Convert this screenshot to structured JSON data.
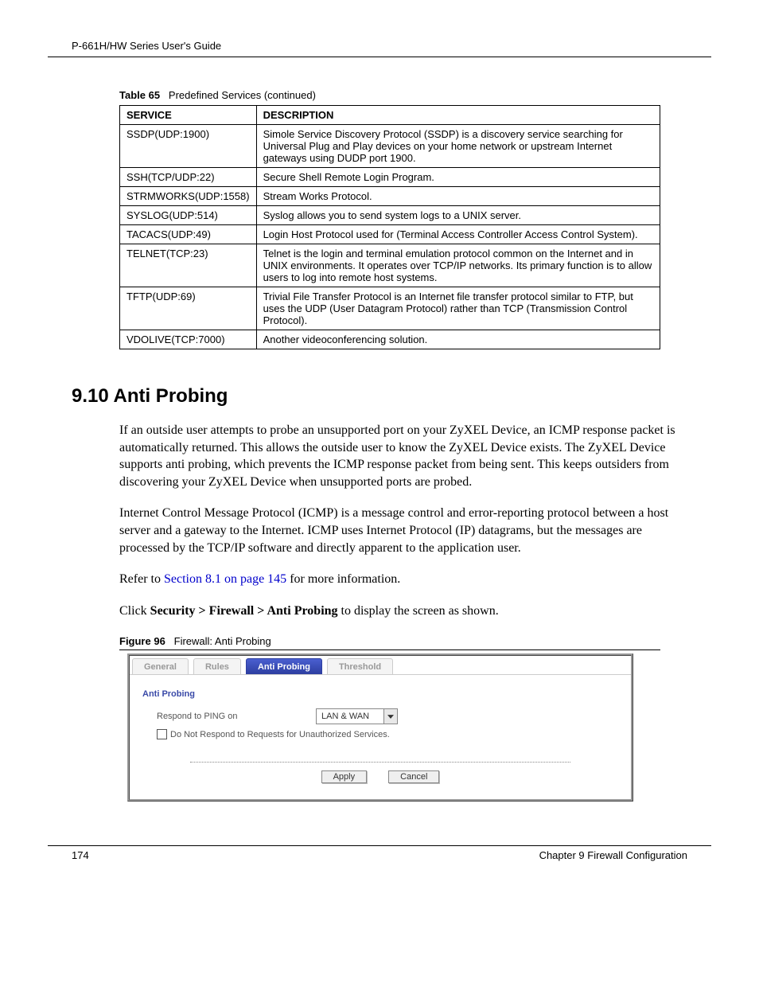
{
  "header": {
    "guide_title": "P-661H/HW Series User's Guide"
  },
  "table": {
    "number": "Table 65",
    "caption": "Predefined Services (continued)",
    "headers": {
      "service": "SERVICE",
      "description": "DESCRIPTION"
    },
    "rows": [
      {
        "service": "SSDP(UDP:1900)",
        "description": "Simole Service Discovery Protocol (SSDP) is a discovery service searching for Universal Plug and Play devices on your home network or upstream Internet gateways using DUDP port 1900."
      },
      {
        "service": "SSH(TCP/UDP:22)",
        "description": "Secure Shell Remote Login Program."
      },
      {
        "service": "STRMWORKS(UDP:1558)",
        "description": "Stream Works Protocol."
      },
      {
        "service": "SYSLOG(UDP:514)",
        "description": "Syslog allows you to send system logs to a UNIX server."
      },
      {
        "service": "TACACS(UDP:49)",
        "description": "Login Host Protocol used for (Terminal Access Controller Access Control System)."
      },
      {
        "service": "TELNET(TCP:23)",
        "description": "Telnet is the login and terminal emulation protocol common on the Internet and in UNIX environments. It operates over TCP/IP networks. Its primary function is to allow users to log into remote host systems."
      },
      {
        "service": "TFTP(UDP:69)",
        "description": "Trivial File Transfer Protocol is an Internet file transfer protocol similar to FTP, but uses the UDP (User Datagram Protocol) rather than TCP (Transmission Control Protocol)."
      },
      {
        "service": "VDOLIVE(TCP:7000)",
        "description": "Another videoconferencing solution."
      }
    ]
  },
  "section": {
    "heading": "9.10  Anti Probing",
    "p1": "If an outside user attempts to probe an unsupported port on your ZyXEL Device, an ICMP response packet is automatically returned. This allows the outside user to know the ZyXEL Device exists. The ZyXEL Device supports anti probing, which prevents the ICMP response packet from being sent. This keeps outsiders from discovering your ZyXEL Device when unsupported ports are probed.",
    "p2": "Internet Control Message Protocol (ICMP) is a message control and error-reporting protocol between a host server and a gateway to the Internet. ICMP uses Internet Protocol (IP) datagrams, but the messages are processed by the TCP/IP software and directly apparent to the application user.",
    "p3_pre": "Refer to ",
    "p3_link": "Section 8.1 on page 145",
    "p3_post": " for more information.",
    "p4_pre": "Click ",
    "p4_bold": "Security > Firewall > Anti Probing",
    "p4_post": " to display the screen as shown."
  },
  "figure": {
    "number": "Figure 96",
    "caption": "Firewall: Anti Probing",
    "tabs": {
      "general": "General",
      "rules": "Rules",
      "anti_probing": "Anti Probing",
      "threshold": "Threshold"
    },
    "panel_heading": "Anti Probing",
    "respond_label": "Respond to PING on",
    "respond_value": "LAN & WAN",
    "checkbox_label": "Do Not Respond to Requests for Unauthorized Services.",
    "apply": "Apply",
    "cancel": "Cancel"
  },
  "footer": {
    "page": "174",
    "chapter": "Chapter 9 Firewall Configuration"
  }
}
